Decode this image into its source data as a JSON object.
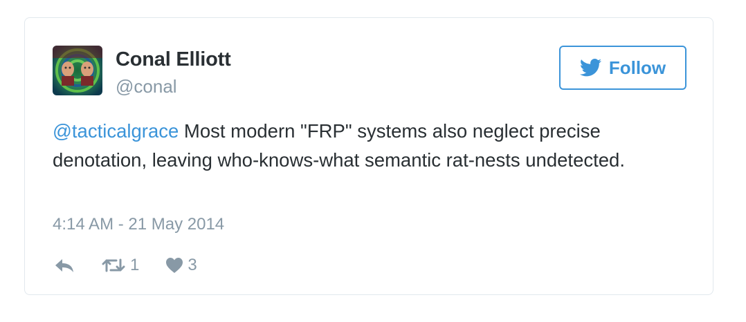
{
  "tweet": {
    "author": {
      "name": "Conal Elliott",
      "handle": "@conal"
    },
    "follow_label": "Follow",
    "text": {
      "mention": "@tacticalgrace",
      "body": " Most modern \"FRP\" systems also neglect precise denotation, leaving who-knows-what semantic rat-nests undetected."
    },
    "timestamp": "4:14 AM - 21 May 2014",
    "actions": {
      "retweet_count": "1",
      "like_count": "3"
    }
  },
  "colors": {
    "accent": "#3b94d9",
    "text": "#292f33",
    "muted": "#8899a6",
    "border": "#e1e8ed"
  },
  "icons": [
    "twitter-bird-icon",
    "reply-icon",
    "retweet-icon",
    "heart-icon"
  ]
}
